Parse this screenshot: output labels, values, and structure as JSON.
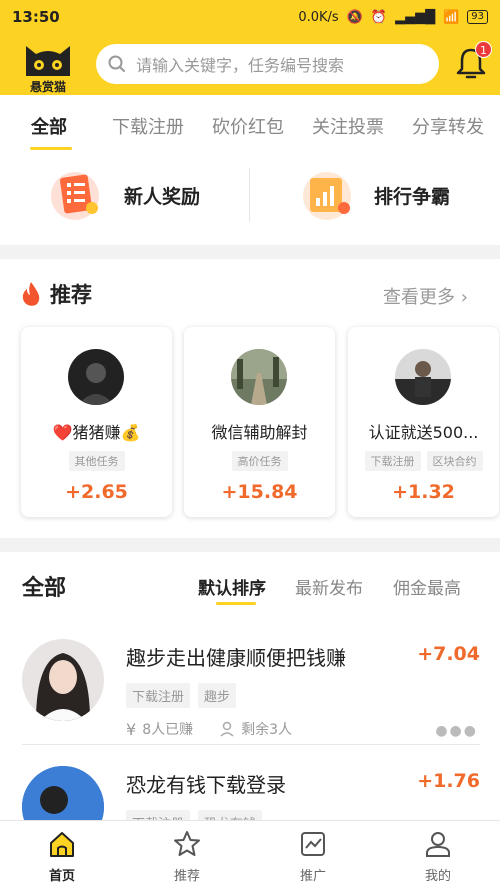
{
  "status_bar": {
    "time": "13:50",
    "network_speed": "0.0K/s",
    "battery": "93"
  },
  "header": {
    "logo_text": "悬赏猫",
    "search_placeholder": "请输入关键字，任务编号搜索",
    "notification_count": "1"
  },
  "category_tabs": [
    "全部",
    "下载注册",
    "砍价红包",
    "关注投票",
    "分享转发"
  ],
  "features": [
    {
      "label": "新人奖励",
      "icon": "gift-list-icon"
    },
    {
      "label": "排行争霸",
      "icon": "ranking-chart-icon"
    }
  ],
  "recommend": {
    "title": "推荐",
    "more": "查看更多",
    "cards": [
      {
        "name": "❤️猪猪赚💰",
        "tags": [
          "其他任务"
        ],
        "reward": "+2.65"
      },
      {
        "name": "微信辅助解封",
        "tags": [
          "高价任务"
        ],
        "reward": "+15.84"
      },
      {
        "name": "认证就送500...",
        "tags": [
          "下载注册",
          "区块合约"
        ],
        "reward": "+1.32"
      }
    ]
  },
  "all_section": {
    "title": "全部",
    "sort_options": [
      "默认排序",
      "最新发布",
      "佣金最高"
    ],
    "tasks": [
      {
        "title": "趣步走出健康顺便把钱赚",
        "reward": "+7.04",
        "tags": [
          "下载注册",
          "趣步"
        ],
        "earned": "8人已赚",
        "remaining": "剩余3人"
      },
      {
        "title": "恐龙有钱下载登录",
        "reward": "+1.76",
        "tags": [
          "下载注册",
          "恐龙有钱"
        ],
        "earned": "",
        "remaining": ""
      }
    ]
  },
  "bottom_nav": [
    {
      "label": "首页",
      "icon": "home-icon"
    },
    {
      "label": "推荐",
      "icon": "star-icon"
    },
    {
      "label": "推广",
      "icon": "promote-chart-icon"
    },
    {
      "label": "我的",
      "icon": "profile-icon"
    }
  ],
  "colors": {
    "brand_yellow": "#fcd223",
    "reward_orange": "#f06a2c",
    "badge_red": "#ec3a3a"
  }
}
